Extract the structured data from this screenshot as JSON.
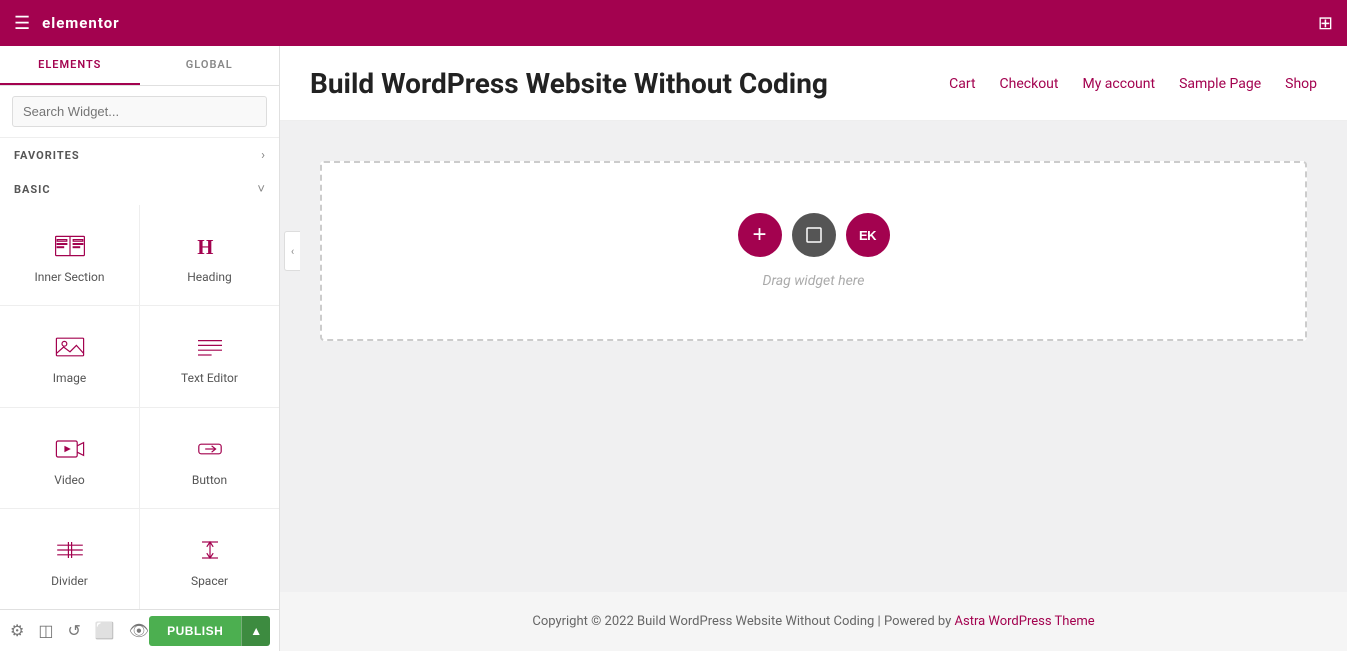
{
  "topbar": {
    "logo": "elementor",
    "hamburger_unicode": "☰",
    "grid_unicode": "⊞"
  },
  "sidebar": {
    "tab_elements": "ELEMENTS",
    "tab_global": "GLOBAL",
    "search_placeholder": "Search Widget...",
    "section_favorites": "FAVORITES",
    "section_basic": "BASIC",
    "widgets": [
      {
        "id": "inner-section",
        "label": "Inner Section",
        "icon_type": "inner_section"
      },
      {
        "id": "heading",
        "label": "Heading",
        "icon_type": "heading"
      },
      {
        "id": "image",
        "label": "Image",
        "icon_type": "image"
      },
      {
        "id": "text-editor",
        "label": "Text Editor",
        "icon_type": "text_editor"
      },
      {
        "id": "video",
        "label": "Video",
        "icon_type": "video"
      },
      {
        "id": "button",
        "label": "Button",
        "icon_type": "button"
      },
      {
        "id": "divider",
        "label": "Divider",
        "icon_type": "divider"
      },
      {
        "id": "spacer",
        "label": "Spacer",
        "icon_type": "spacer"
      }
    ]
  },
  "bottom_toolbar": {
    "publish_label": "PUBLISH",
    "arrow_char": "▲"
  },
  "page": {
    "title": "Build WordPress Website Without Coding",
    "nav_links": [
      "Cart",
      "Checkout",
      "My account",
      "Sample Page",
      "Shop"
    ],
    "drag_hint": "Drag widget here",
    "drag_btn_ek": "EK",
    "footer_text": "Copyright © 2022 Build WordPress Website Without Coding | Powered by ",
    "footer_link_text": "Astra WordPress Theme",
    "footer_link_suffix": ""
  }
}
